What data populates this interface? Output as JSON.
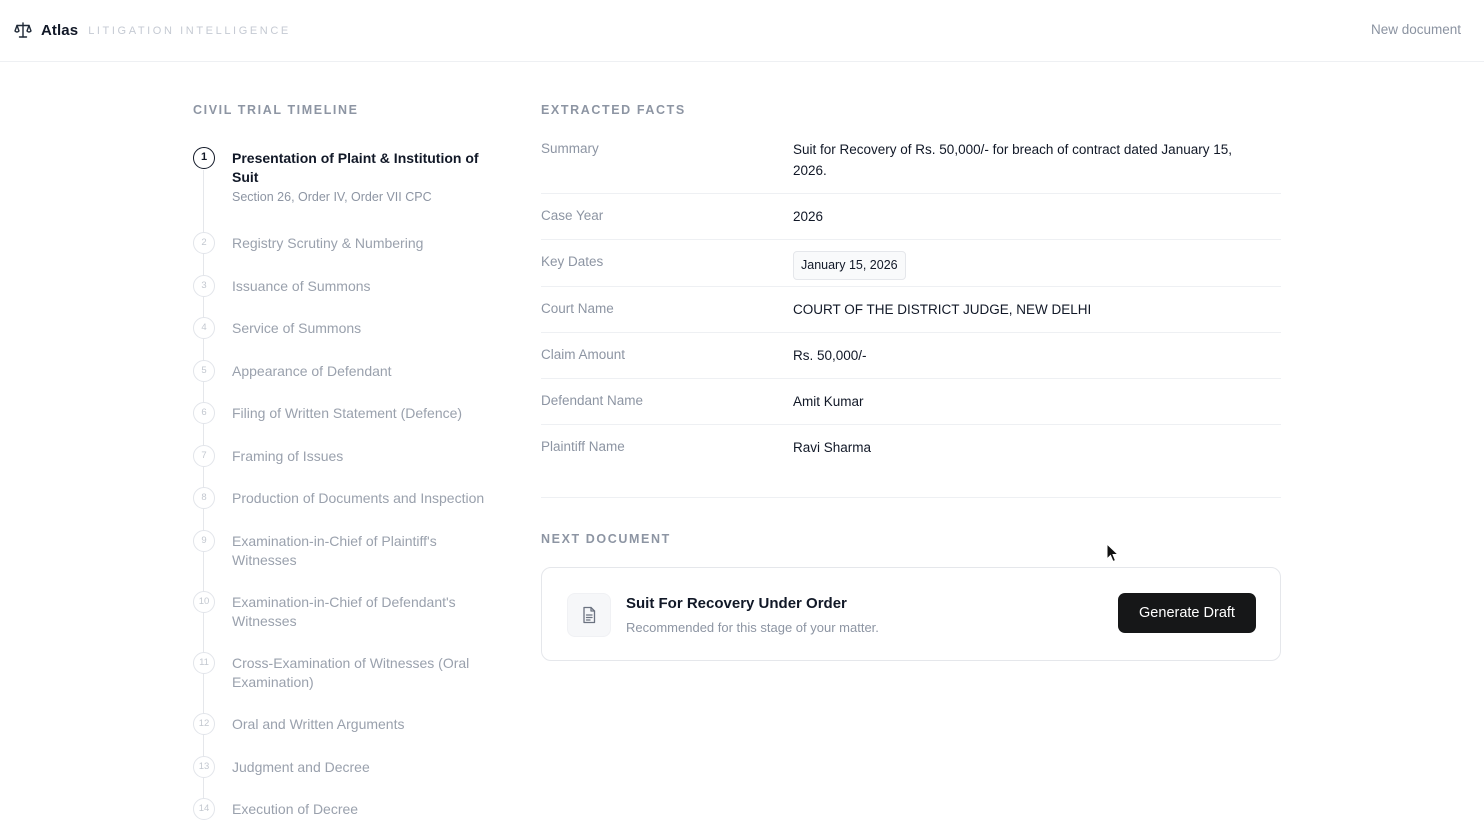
{
  "app": {
    "name": "Atlas",
    "tagline": "LITIGATION INTELLIGENCE",
    "new_document_label": "New document"
  },
  "timeline": {
    "title": "CIVIL TRIAL TIMELINE",
    "steps": [
      {
        "num": "1",
        "label": "Presentation of Plaint & Institution of Suit",
        "sub": "Section 26, Order IV, Order VII CPC",
        "active": true
      },
      {
        "num": "2",
        "label": "Registry Scrutiny & Numbering"
      },
      {
        "num": "3",
        "label": "Issuance of Summons"
      },
      {
        "num": "4",
        "label": "Service of Summons"
      },
      {
        "num": "5",
        "label": "Appearance of Defendant"
      },
      {
        "num": "6",
        "label": "Filing of Written Statement (Defence)"
      },
      {
        "num": "7",
        "label": "Framing of Issues"
      },
      {
        "num": "8",
        "label": "Production of Documents and Inspection"
      },
      {
        "num": "9",
        "label": "Examination-in-Chief of Plaintiff's Witnesses"
      },
      {
        "num": "10",
        "label": "Examination-in-Chief of Defendant's Witnesses"
      },
      {
        "num": "11",
        "label": "Cross-Examination of Witnesses (Oral Examination)"
      },
      {
        "num": "12",
        "label": "Oral and Written Arguments"
      },
      {
        "num": "13",
        "label": "Judgment and Decree"
      },
      {
        "num": "14",
        "label": "Execution of Decree"
      }
    ]
  },
  "facts": {
    "title": "EXTRACTED FACTS",
    "rows": [
      {
        "key": "Summary",
        "value": "Suit for Recovery of Rs. 50,000/- for breach of contract dated January 15, 2026."
      },
      {
        "key": "Case Year",
        "value": "2026"
      },
      {
        "key": "Key Dates",
        "value": "January 15, 2026"
      },
      {
        "key": "Court Name",
        "value": "COURT OF THE DISTRICT JUDGE, NEW DELHI"
      },
      {
        "key": "Claim Amount",
        "value": "Rs. 50,000/-"
      },
      {
        "key": "Defendant Name",
        "value": "Amit Kumar"
      },
      {
        "key": "Plaintiff Name",
        "value": "Ravi Sharma"
      }
    ]
  },
  "next_document": {
    "title": "NEXT DOCUMENT",
    "name": "Suit For Recovery Under Order",
    "description": "Recommended for this stage of your matter.",
    "button_label": "Generate Draft",
    "icon": "document-icon"
  },
  "icons": {
    "brand": "scale-icon",
    "cursor": "cursor-icon"
  }
}
